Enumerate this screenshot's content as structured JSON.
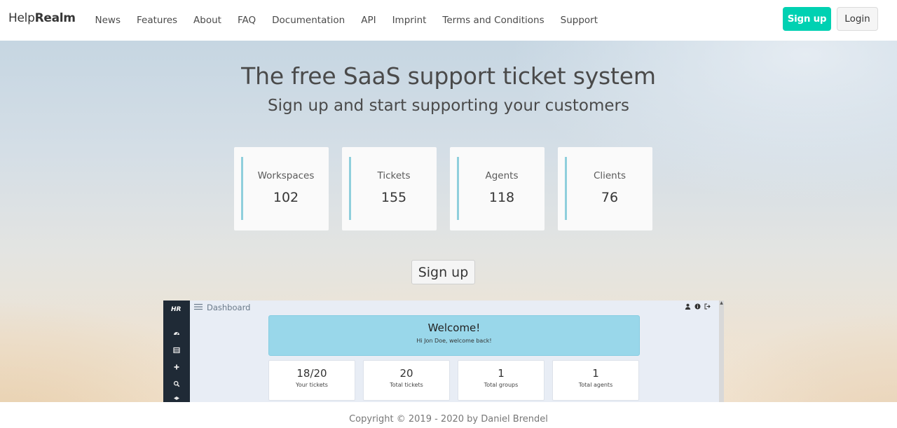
{
  "brand": {
    "prefix": "Help",
    "suffix": "Realm"
  },
  "nav": {
    "links": [
      "News",
      "Features",
      "About",
      "FAQ",
      "Documentation",
      "API",
      "Imprint",
      "Terms and Conditions",
      "Support"
    ],
    "signup_label": "Sign up",
    "login_label": "Login"
  },
  "colors": {
    "accent": "#00d1b2",
    "stat_bar": "#8fcfdc",
    "welcome_bg": "#99d7ea"
  },
  "hero": {
    "title": "The free SaaS support ticket system",
    "subtitle": "Sign up and start supporting your customers",
    "stats": [
      {
        "label": "Workspaces",
        "value": "102"
      },
      {
        "label": "Tickets",
        "value": "155"
      },
      {
        "label": "Agents",
        "value": "118"
      },
      {
        "label": "Clients",
        "value": "76"
      }
    ],
    "signup_label": "Sign up"
  },
  "preview": {
    "logo": "HR",
    "page_title": "Dashboard",
    "sidebar_icons": [
      "dashboard-icon",
      "list-icon",
      "plus-icon",
      "search-icon",
      "layers-icon"
    ],
    "top_icons": [
      "user-icon",
      "info-icon",
      "logout-icon"
    ],
    "welcome_title": "Welcome!",
    "welcome_sub": "Hi Jon Doe, welcome back!",
    "tiles": [
      {
        "value": "18/20",
        "label": "Your tickets"
      },
      {
        "value": "20",
        "label": "Total tickets"
      },
      {
        "value": "1",
        "label": "Total groups"
      },
      {
        "value": "1",
        "label": "Total agents"
      }
    ]
  },
  "footer": {
    "text": "Copyright © 2019 - 2020 by Daniel Brendel"
  }
}
